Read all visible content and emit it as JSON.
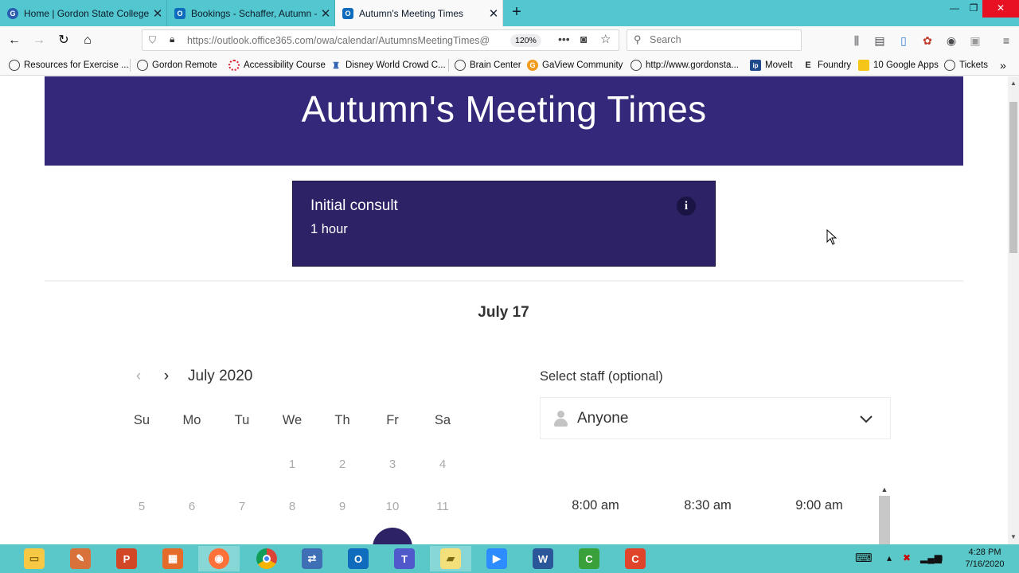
{
  "browser": {
    "tabs": [
      {
        "label": "Home | Gordon State College",
        "icon": "gordon-icon"
      },
      {
        "label": "Bookings - Schaffer, Autumn -",
        "icon": "outlook-icon"
      },
      {
        "label": "Autumn's Meeting Times",
        "icon": "outlook-icon"
      }
    ],
    "url": "https://outlook.office365.com/owa/calendar/AutumnsMeetingTimes@",
    "zoom": "120%",
    "search_placeholder": "Search",
    "bookmarks": [
      {
        "label": "Resources for Exercise ...",
        "icon": "globe-icon"
      },
      {
        "label": "Gordon Remote",
        "icon": "globe-icon"
      },
      {
        "label": "Accessibility Course",
        "icon": "ring-icon"
      },
      {
        "label": "Disney World Crowd C...",
        "icon": "castle-icon"
      },
      {
        "label": "Brain Center",
        "icon": "globe-icon"
      },
      {
        "label": "GaView Community",
        "icon": "gaview-icon"
      },
      {
        "label": "http://www.gordonsta...",
        "icon": "globe-icon"
      },
      {
        "label": "MoveIt",
        "icon": "moveit-icon"
      },
      {
        "label": "Foundry",
        "icon": "foundry-icon"
      },
      {
        "label": "10 Google Apps",
        "icon": "folder-icon"
      },
      {
        "label": "Tickets",
        "icon": "globe-icon"
      }
    ]
  },
  "page": {
    "title": "Autumn's Meeting Times",
    "service": {
      "name": "Initial consult",
      "duration": "1 hour",
      "info": "i"
    },
    "selected_date": "July 17",
    "calendar": {
      "month": "July 2020",
      "weekdays": [
        "Su",
        "Mo",
        "Tu",
        "We",
        "Th",
        "Fr",
        "Sa"
      ],
      "week1": [
        "1",
        "2",
        "3",
        "4"
      ],
      "week2": [
        "5",
        "6",
        "7",
        "8",
        "9",
        "10",
        "11"
      ]
    },
    "staff": {
      "label": "Select staff (optional)",
      "value": "Anyone"
    },
    "time_slots": [
      "8:00 am",
      "8:30 am",
      "9:00 am"
    ]
  },
  "taskbar": {
    "apps": [
      "file-explorer",
      "tool",
      "powerpoint",
      "store",
      "firefox",
      "chrome",
      "network",
      "outlook",
      "teams",
      "sticky-notes",
      "zoom",
      "word",
      "camtasia",
      "camtasia-recorder"
    ],
    "time": "4:28 PM",
    "date": "7/16/2020"
  },
  "colors": {
    "brand": "#33287a",
    "service_card": "#2d2265",
    "tabstrip": "#53c7cf",
    "taskbar": "#5ac8c8"
  }
}
